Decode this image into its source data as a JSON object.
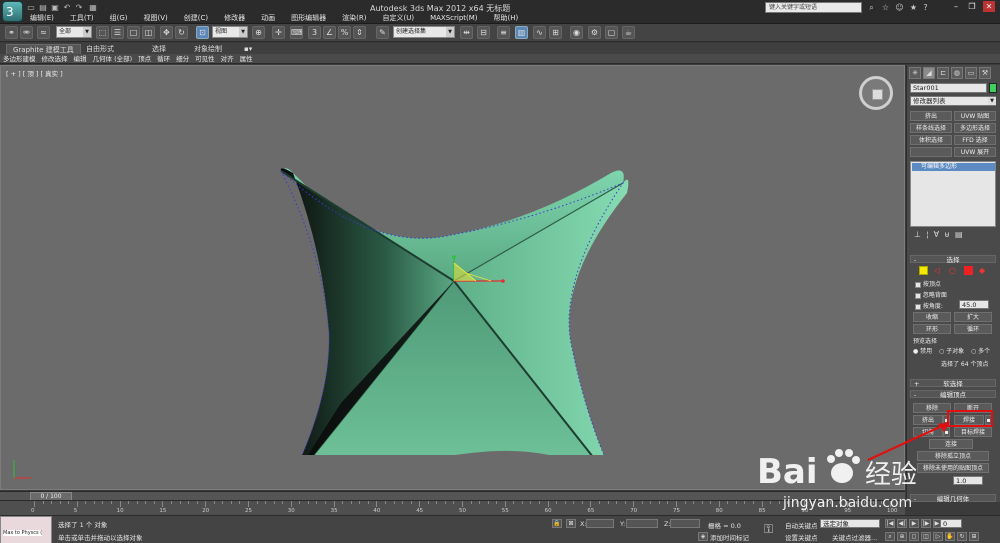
{
  "window": {
    "title": "Autodesk 3ds Max  2012 x64    无标题",
    "search_placeholder": "键入关键字或短语"
  },
  "menu": [
    "编辑(E)",
    "工具(T)",
    "组(G)",
    "视图(V)",
    "创建(C)",
    "修改器",
    "动画",
    "图形编辑器",
    "渲染(R)",
    "自定义(U)",
    "MAXScript(M)",
    "帮助(H)"
  ],
  "toolbar": {
    "selection_filter": "全部",
    "ref_coord": "视图",
    "named_selection": "创建选择集"
  },
  "ribbon": {
    "tabs": [
      "Graphite 建模工具",
      "自由形式",
      "选择",
      "对象绘制"
    ],
    "active_tab": "Graphite 建模工具",
    "sub_items": [
      "多边形建模",
      "修改选择",
      "编辑",
      "几何体 (全部)",
      "顶点",
      "循环",
      "细分",
      "可见性",
      "对齐",
      "属性"
    ]
  },
  "viewport": {
    "label": "[ + ] [ 顶 ] [ 真实 ]"
  },
  "command_panel": {
    "object_name": "Star001",
    "object_color": "#3fcf5f",
    "modifier_list": "修改器列表",
    "modifier_buttons": [
      [
        "挤出",
        "UVW 贴图"
      ],
      [
        "样条线选择",
        "多边形选择"
      ],
      [
        "体积选择",
        "FFD 选择"
      ],
      [
        "",
        "UVW 展开"
      ]
    ],
    "stack_item": "可编辑多边形",
    "selection_rollout": {
      "title": "选择",
      "by_vertex": "按顶点",
      "ignore_backfacing": "忽略背面",
      "by_angle": "按角度:",
      "angle_value": "45.0",
      "shrink": "收缩",
      "grow": "扩大",
      "ring": "环形",
      "loop": "循环",
      "preview_selection": "预览选择",
      "preview_disabled": "禁用",
      "preview_subobject": "子对象",
      "preview_multi": "多个",
      "status": "选择了 64 个顶点"
    },
    "soft_selection": "软选择",
    "edit_vertices": {
      "title": "编辑顶点",
      "remove": "移除",
      "break": "断开",
      "extrude": "挤出",
      "weld": "焊接",
      "chamfer": "切角",
      "target_weld": "目标焊接",
      "connect": "连接",
      "remove_isolated": "移除孤立顶点",
      "remove_unused_map": "移除未使用的贴图顶点",
      "weight_value": "1.0"
    },
    "edit_geometry": "编辑几何体"
  },
  "timeline": {
    "frame_display": "0 / 100",
    "ticks": [
      "0",
      "5",
      "10",
      "15",
      "20",
      "25",
      "30",
      "35",
      "40",
      "45",
      "50",
      "55",
      "60",
      "65",
      "70",
      "75",
      "80",
      "85",
      "90",
      "95",
      "100"
    ]
  },
  "status": {
    "maxscript_text": "Max to Physcs (",
    "selected": "选择了 1 个 对象",
    "prompt": "单击或单击并拖动以选择对象",
    "x_label": "X:",
    "y_label": "Y:",
    "z_label": "Z:",
    "grid": "栅格 = 0.0",
    "add_time_tag": "添加时间标记",
    "auto_key": "自动关键点",
    "set_key": "设置关键点",
    "key_mode": "选定对象",
    "key_filters": "关键点过滤器...",
    "frame": "0"
  },
  "watermark": {
    "brand": "Bai 经验",
    "url": "jingyan.baidu.com"
  },
  "colors": {
    "mesh_light": "#6ec9a0",
    "mesh_dark": "#2a7a55",
    "highlight": "#e01010"
  }
}
